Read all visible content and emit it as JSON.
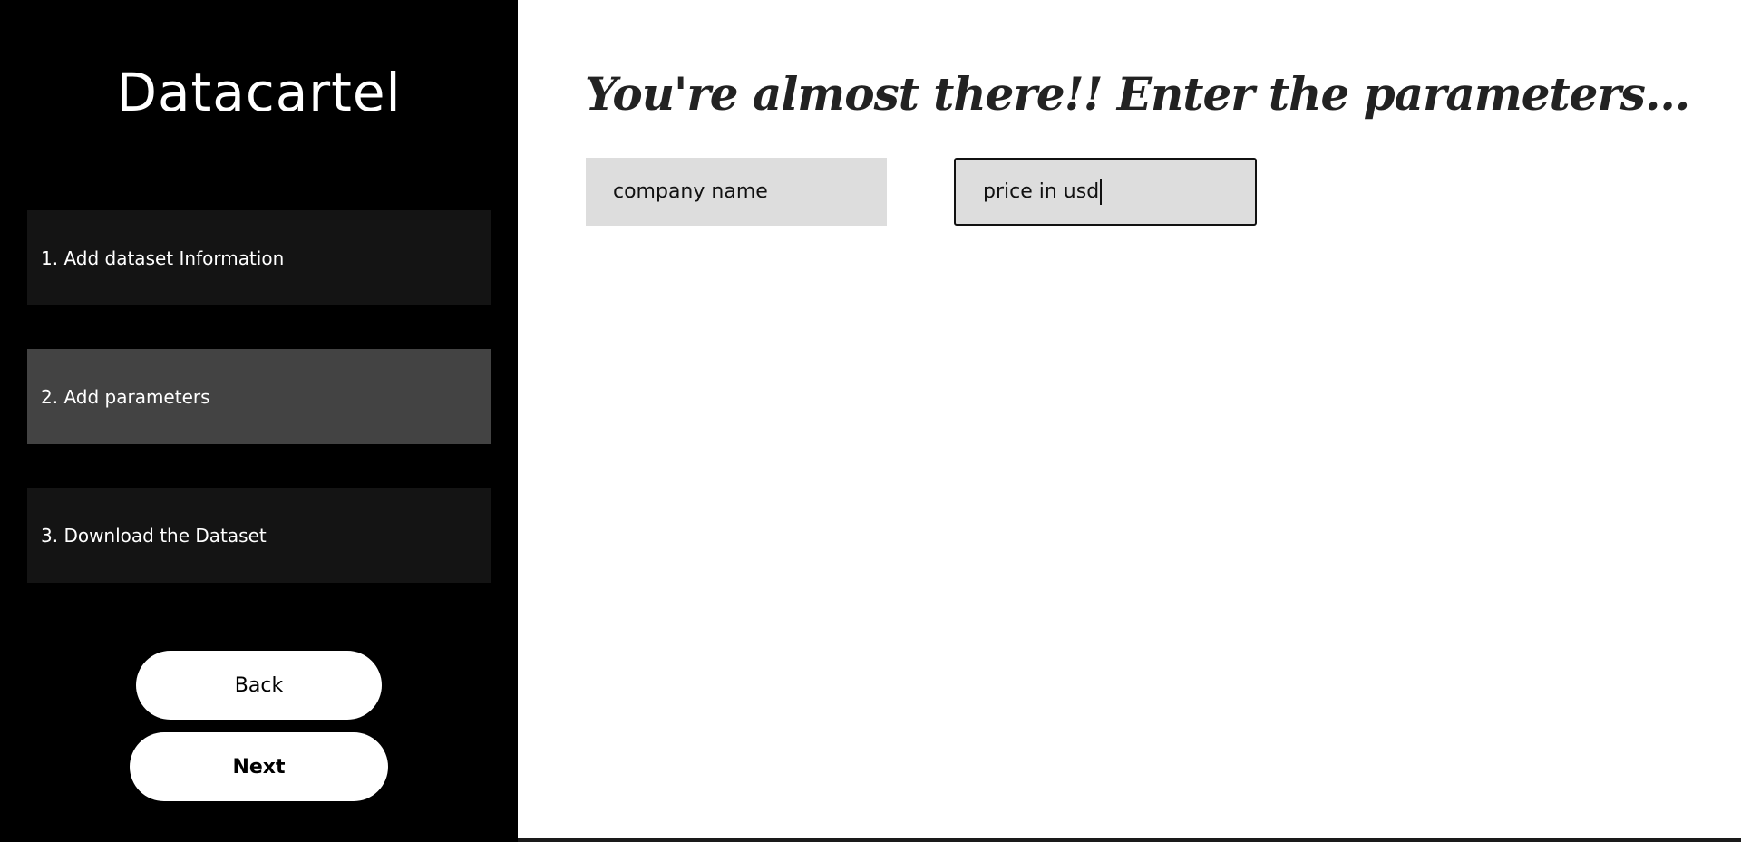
{
  "sidebar": {
    "brand": "Datacartel",
    "steps": [
      {
        "label": "1. Add dataset Information",
        "active": false
      },
      {
        "label": "2. Add parameters",
        "active": true
      },
      {
        "label": "3. Download the Dataset",
        "active": false
      }
    ],
    "back_label": "Back",
    "next_label": "Next"
  },
  "main": {
    "heading": "You're almost there!! Enter the parameters...",
    "parameters": [
      {
        "value": "company name"
      },
      {
        "value": "price in usd"
      }
    ]
  },
  "colors": {
    "sidebar_bg": "#000000",
    "step_bg": "#141414",
    "step_active_bg": "#434343",
    "field_bg": "#dddddd"
  }
}
